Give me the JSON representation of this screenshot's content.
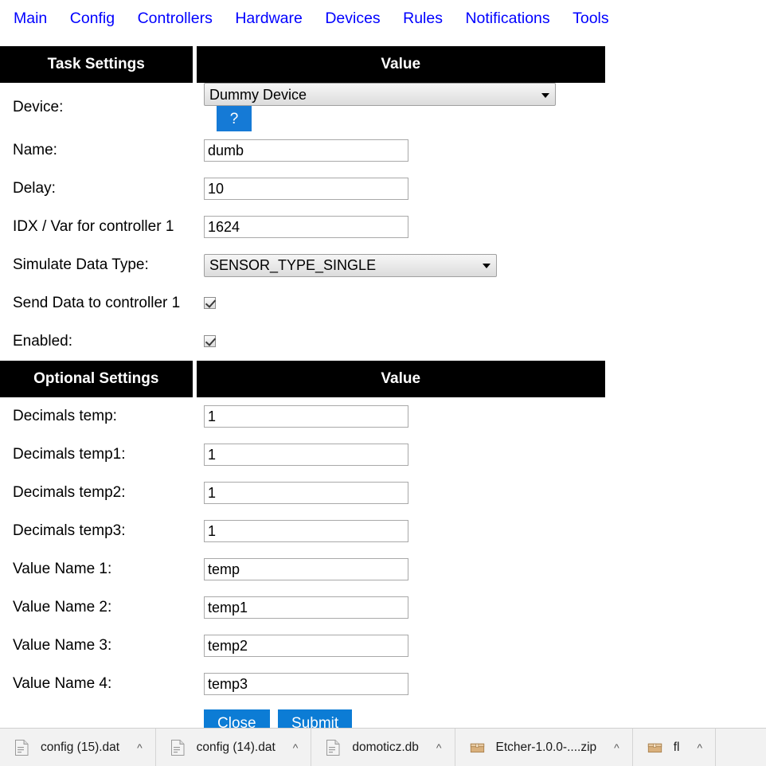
{
  "nav": {
    "items": [
      {
        "label": "Main"
      },
      {
        "label": "Config"
      },
      {
        "label": "Controllers"
      },
      {
        "label": "Hardware"
      },
      {
        "label": "Devices"
      },
      {
        "label": "Rules"
      },
      {
        "label": "Notifications"
      },
      {
        "label": "Tools"
      }
    ]
  },
  "task_settings": {
    "header_left": "Task Settings",
    "header_right": "Value",
    "device_label": "Device:",
    "device_value": "Dummy Device",
    "help_label": "?",
    "name_label": "Name:",
    "name_value": "dumb",
    "delay_label": "Delay:",
    "delay_value": "10",
    "idx_label": "IDX / Var for controller 1",
    "idx_value": "1624",
    "datatype_label": "Simulate Data Type:",
    "datatype_value": "SENSOR_TYPE_SINGLE",
    "send_label": "Send Data to controller 1",
    "send_checked": true,
    "enabled_label": "Enabled:",
    "enabled_checked": true
  },
  "optional_settings": {
    "header_left": "Optional Settings",
    "header_right": "Value",
    "rows": [
      {
        "label": "Decimals temp:",
        "value": "1"
      },
      {
        "label": "Decimals temp1:",
        "value": "1"
      },
      {
        "label": "Decimals temp2:",
        "value": "1"
      },
      {
        "label": "Decimals temp3:",
        "value": "1"
      },
      {
        "label": "Value Name 1:",
        "value": "temp"
      },
      {
        "label": "Value Name 2:",
        "value": "temp1"
      },
      {
        "label": "Value Name 3:",
        "value": "temp2"
      },
      {
        "label": "Value Name 4:",
        "value": "temp3"
      }
    ]
  },
  "actions": {
    "close_label": "Close",
    "submit_label": "Submit"
  },
  "downloads": [
    {
      "name": "config (15).dat",
      "icon": "file-icon"
    },
    {
      "name": "config (14).dat",
      "icon": "file-icon"
    },
    {
      "name": "domoticz.db",
      "icon": "file-icon"
    },
    {
      "name": "Etcher-1.0.0-....zip",
      "icon": "archive-icon"
    },
    {
      "name": "fl",
      "icon": "archive-icon"
    }
  ],
  "colors": {
    "link": "#0000ff",
    "header_bg": "#000000",
    "accent_blue": "#0c7cd5",
    "help_blue": "#157ad6",
    "downloadbar_bg": "#f2f2f2"
  }
}
